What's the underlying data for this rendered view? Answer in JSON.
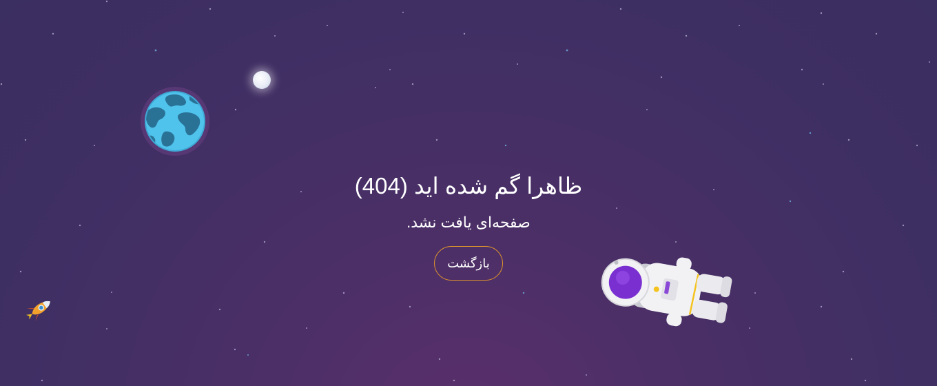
{
  "page": {
    "title": "ظاهرا گم شده اید (404)",
    "subtitle": "صفحه‌ای یافت نشد.",
    "back_button": "بازگشت"
  },
  "colors": {
    "background": "#3f2f63",
    "button_border": "#e1962a",
    "text": "#ffffff"
  },
  "icons": [
    "moon-icon",
    "earth-icon",
    "rocket-icon",
    "astronaut-icon"
  ]
}
